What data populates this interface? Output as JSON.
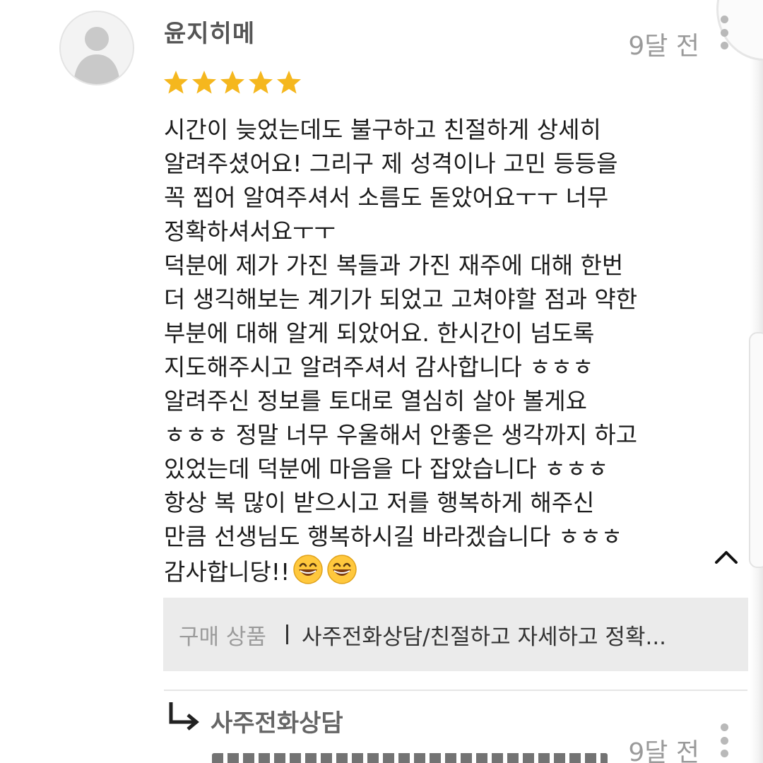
{
  "review": {
    "username": "윤지히메",
    "date": "9달 전",
    "rating": 5,
    "rating_max": 5,
    "star_color": "#f5b71e",
    "lines": [
      "시간이 늦었는데도 불구하고 친절하게 상세히",
      "알려주셨어요! 그리구 제 성격이나 고민 등등을",
      "꼭 찝어 알여주셔서 소름도 돋았어요ㅜㅜ 너무",
      "정확하셔서요ㅜㅜ",
      "덕분에 제가 가진 복들과 가진 재주에 대해 한번",
      "더 생긱해보는 계기가 되었고 고쳐야할 점과 약한",
      "부분에 대해 알게 되았어요. 한시간이 넘도록",
      "지도해주시고 알려주셔서 감사합니다 ㅎㅎㅎ",
      "알려주신 정보를 토대로 열심히 살아 볼게요",
      "ㅎㅎㅎ 정말 너무 우울해서 안좋은 생각까지 하고",
      "있었는데 덕분에 마음을 다 잡았습니다 ㅎㅎㅎ",
      "항상 복 많이 받으시고 저를 행복하게 해주신",
      "만큼 선생님도 행복하시길 바라겠습니다 ㅎㅎㅎ",
      "감사합니당!!"
    ],
    "emoji_icons": [
      "grinning-face-emoji",
      "grinning-face-emoji"
    ]
  },
  "product": {
    "label": "구매 상품",
    "name": "사주전화상담/친절하고 자세하고 정확..."
  },
  "reply": {
    "name": "사주전화상담",
    "date": "9달 전"
  },
  "icons": {
    "avatar": "default-user-avatar-icon",
    "more": "kebab-menu-icon",
    "collapse": "chevron-up-icon",
    "reply": "reply-arrow-icon"
  }
}
